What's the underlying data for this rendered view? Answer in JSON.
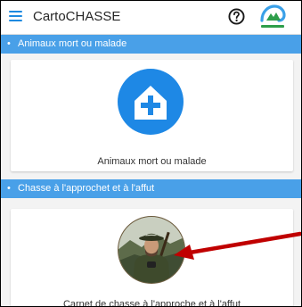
{
  "app": {
    "title": "CartoCHASSE",
    "menu_icon": "hamburger-menu-icon",
    "help_icon": "question-mark-icon",
    "logo_icon": "cartochasse-logo-icon"
  },
  "sections": [
    {
      "header": "Animaux mort ou malade",
      "card_label": "Animaux mort ou malade",
      "icon": "house-plus-icon"
    },
    {
      "header": "Chasse à l'approchet et à l'affut",
      "card_label": "Carnet de chasse à l'approche et à l'affut",
      "icon": "hunter-portrait-icon"
    }
  ],
  "annotation": {
    "arrow": "red-arrow-pointer-icon"
  },
  "colors": {
    "accent": "#1e8ae0",
    "section_header": "#49a0e8",
    "icon_circle": "#1e88e5",
    "arrow": "#c00000",
    "background": "#f3f3f3"
  }
}
